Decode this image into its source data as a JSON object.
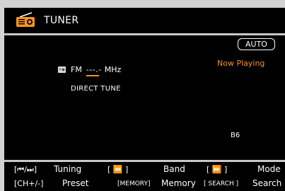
{
  "header": {
    "title": "TUNER",
    "icon": "radio-icon"
  },
  "status": {
    "mode_badge": "AUTO",
    "now_playing": "Now Playing"
  },
  "frequency": {
    "band": "FM",
    "digits": "---.-",
    "unit": "MHz",
    "mode_label": "DIRECT TUNE"
  },
  "preset_code": "B6",
  "footer": {
    "tuning_key": "[⏮/⏭]",
    "tuning_label": "Tuning",
    "band_key": "[ ⏪ ]",
    "band_label": "Band",
    "mode_key": "[ ⏩ ]",
    "mode_label": "Mode",
    "preset_key": "[CH+/-]",
    "preset_label": "Preset",
    "memory_key": "[MEMORY]",
    "memory_label": "Memory",
    "search_key": "[ SEARCH ]",
    "search_label": "Search"
  },
  "colors": {
    "accent": "#f7941d",
    "background": "#000000",
    "bezel": "#d2d2d2"
  }
}
